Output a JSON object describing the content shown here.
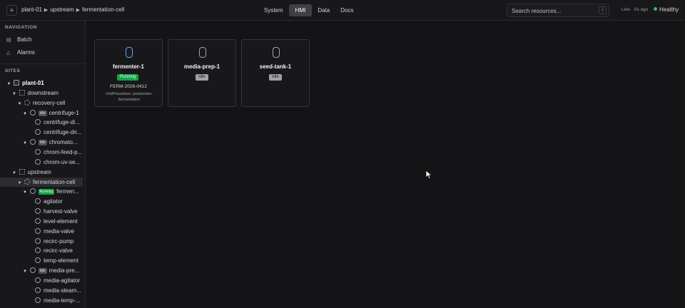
{
  "header": {
    "menu_icon": "menu-icon",
    "breadcrumb": [
      "plant-01",
      "upstream",
      "fermentation-cell"
    ],
    "tabs": [
      {
        "label": "System",
        "active": false
      },
      {
        "label": "HMI",
        "active": true
      },
      {
        "label": "Data",
        "active": false
      },
      {
        "label": "Docs",
        "active": false
      }
    ],
    "search": {
      "placeholder": "Search resources...",
      "shortcut": "/"
    },
    "live_status": "Live · 0s ago",
    "health": {
      "label": "Healthy",
      "color": "#22c55e"
    }
  },
  "sidebar": {
    "navigation_title": "NAVIGATION",
    "nav_items": [
      {
        "label": "Batch",
        "icon": "document-icon"
      },
      {
        "label": "Alarms",
        "icon": "alarm-icon"
      }
    ],
    "sites_title": "SITES",
    "tree": [
      {
        "label": "plant-01",
        "kind": "site",
        "level": 0,
        "expanded": true,
        "bold": true
      },
      {
        "label": "downstream",
        "kind": "area",
        "level": 1,
        "expanded": true
      },
      {
        "label": "recovery-cell",
        "kind": "cell",
        "level": 2,
        "expanded": true
      },
      {
        "label": "centrifuge-1",
        "kind": "unit",
        "level": 3,
        "expanded": true,
        "chip": "Idle"
      },
      {
        "label": "centrifuge-di...",
        "kind": "module",
        "level": 4
      },
      {
        "label": "centrifuge-dri...",
        "kind": "module",
        "level": 4
      },
      {
        "label": "chromato...",
        "kind": "unit",
        "level": 3,
        "expanded": true,
        "chip": "Idle"
      },
      {
        "label": "chrom-feed-p...",
        "kind": "module",
        "level": 4
      },
      {
        "label": "chrom-uv-se...",
        "kind": "module",
        "level": 4
      },
      {
        "label": "upstream",
        "kind": "area",
        "level": 1,
        "expanded": true
      },
      {
        "label": "fermentation-cell",
        "kind": "cell",
        "level": 2,
        "expanded": true,
        "selected": true
      },
      {
        "label": "fermen...",
        "kind": "unit",
        "level": 3,
        "expanded": true,
        "chip": "Running"
      },
      {
        "label": "agitator",
        "kind": "module",
        "level": 4
      },
      {
        "label": "harvest-valve",
        "kind": "module",
        "level": 4
      },
      {
        "label": "level-element",
        "kind": "module",
        "level": 4
      },
      {
        "label": "media-valve",
        "kind": "module",
        "level": 4
      },
      {
        "label": "recirc-pump",
        "kind": "module",
        "level": 4
      },
      {
        "label": "recirc-valve",
        "kind": "module",
        "level": 4
      },
      {
        "label": "temp-element",
        "kind": "module",
        "level": 4
      },
      {
        "label": "media-pre...",
        "kind": "unit",
        "level": 3,
        "expanded": true,
        "chip": "Idle"
      },
      {
        "label": "media-agitator",
        "kind": "module",
        "level": 4
      },
      {
        "label": "media-steam...",
        "kind": "module",
        "level": 4
      },
      {
        "label": "media-temp-...",
        "kind": "module",
        "level": 4
      }
    ]
  },
  "main": {
    "units": [
      {
        "name": "fermenter-1",
        "status": "Running",
        "batch_id": "FERM-2026-0412",
        "procedure": "UnitProcedure: production-fermentation"
      },
      {
        "name": "media-prep-1",
        "status": "Idle"
      },
      {
        "name": "seed-tank-1",
        "status": "Idle"
      }
    ]
  }
}
